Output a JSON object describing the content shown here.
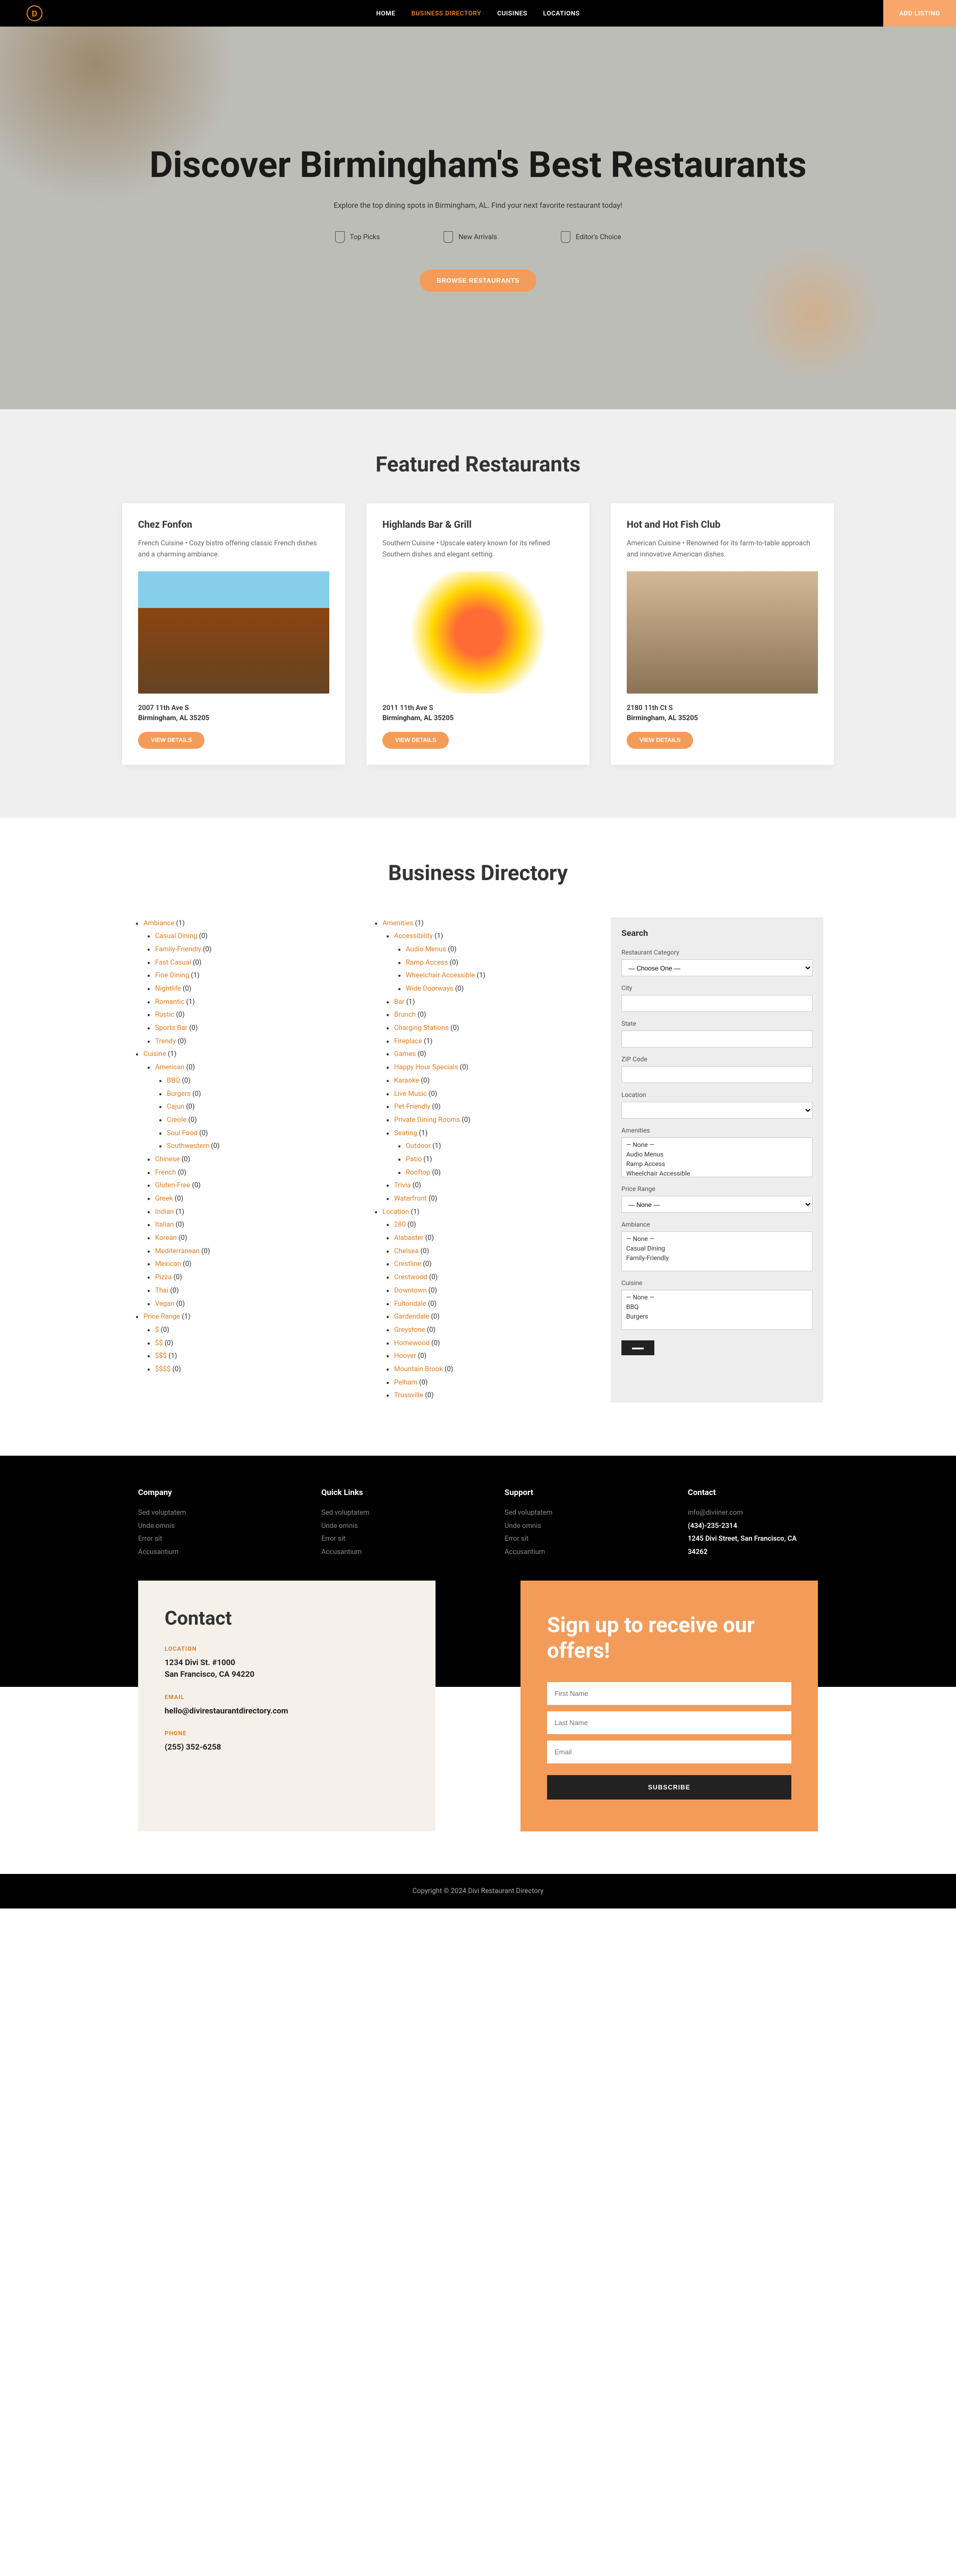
{
  "header": {
    "nav": [
      "HOME",
      "BUSINESS DIRECTORY",
      "CUISINES",
      "LOCATIONS"
    ],
    "cta": "ADD LISTING"
  },
  "hero": {
    "title": "Discover Birmingham's Best Restaurants",
    "subtitle": "Explore the top dining spots in Birmingham, AL. Find your next favorite restaurant today!",
    "badges": [
      "Top Picks",
      "New Arrivals",
      "Editor's Choice"
    ],
    "button": "BROWSE RESTAURANTS"
  },
  "featured": {
    "title": "Featured Restaurants",
    "cards": [
      {
        "name": "Chez Fonfon",
        "desc": "French Cuisine • Cozy bistro offering classic French dishes and a charming ambiance.",
        "addr": "2007 11th Ave S",
        "city": "Birmingham, AL 35205",
        "btn": "VIEW DETAILS"
      },
      {
        "name": "Highlands Bar & Grill",
        "desc": "Southern Cuisine • Upscale eatery known for its refined Southern dishes and elegant setting.",
        "addr": "2011 11th Ave S",
        "city": "Birmingham, AL 35205",
        "btn": "VIEW DETAILS"
      },
      {
        "name": "Hot and Hot Fish Club",
        "desc": "American Cuisine • Renowned for its farm-to-table approach and innovative American dishes.",
        "addr": "2180 11th Ct S",
        "city": "Birmingham, AL 35205",
        "btn": "VIEW DETAILS"
      }
    ]
  },
  "directory": {
    "title": "Business Directory",
    "col1": [
      {
        "label": "Ambiance",
        "count": "(1)",
        "children": [
          {
            "label": "Casual Dining",
            "count": "(0)"
          },
          {
            "label": "Family-Friendly",
            "count": "(0)"
          },
          {
            "label": "Fast Casual",
            "count": "(0)"
          },
          {
            "label": "Fine Dining",
            "count": "(1)"
          },
          {
            "label": "Nightlife",
            "count": "(0)"
          },
          {
            "label": "Romantic",
            "count": "(1)"
          },
          {
            "label": "Rustic",
            "count": "(0)"
          },
          {
            "label": "Sports Bar",
            "count": "(0)"
          },
          {
            "label": "Trendy",
            "count": "(0)"
          }
        ]
      },
      {
        "label": "Cuisine",
        "count": "(1)",
        "children": [
          {
            "label": "American",
            "count": "(0)",
            "children": [
              {
                "label": "BBQ",
                "count": "(0)"
              },
              {
                "label": "Burgers",
                "count": "(0)"
              },
              {
                "label": "Cajun",
                "count": "(0)"
              },
              {
                "label": "Creole",
                "count": "(0)"
              },
              {
                "label": "Soul Food",
                "count": "(0)"
              },
              {
                "label": "Southwestern",
                "count": "(0)"
              }
            ]
          },
          {
            "label": "Chinese",
            "count": "(0)"
          },
          {
            "label": "French",
            "count": "(0)"
          },
          {
            "label": "Gluten-Free",
            "count": "(0)"
          },
          {
            "label": "Greek",
            "count": "(0)"
          },
          {
            "label": "Indian",
            "count": "(1)"
          },
          {
            "label": "Italian",
            "count": "(0)"
          },
          {
            "label": "Korean",
            "count": "(0)"
          },
          {
            "label": "Mediterranean",
            "count": "(0)"
          },
          {
            "label": "Mexican",
            "count": "(0)"
          },
          {
            "label": "Pizza",
            "count": "(0)"
          },
          {
            "label": "Thai",
            "count": "(0)"
          },
          {
            "label": "Vegan",
            "count": "(0)"
          }
        ]
      },
      {
        "label": "Price Range",
        "count": "(1)",
        "children": [
          {
            "label": "$",
            "count": "(0)"
          },
          {
            "label": "$$",
            "count": "(0)"
          },
          {
            "label": "$$$",
            "count": "(1)"
          },
          {
            "label": "$$$$",
            "count": "(0)"
          }
        ]
      }
    ],
    "col2": [
      {
        "label": "Amenities",
        "count": "(1)",
        "children": [
          {
            "label": "Accessibility",
            "count": "(1)",
            "children": [
              {
                "label": "Audio Menus",
                "count": "(0)"
              },
              {
                "label": "Ramp Access",
                "count": "(0)"
              },
              {
                "label": "Wheelchair Accessible",
                "count": "(1)"
              },
              {
                "label": "Wide Doorways",
                "count": "(0)"
              }
            ]
          },
          {
            "label": "Bar",
            "count": "(1)"
          },
          {
            "label": "Brunch",
            "count": "(0)"
          },
          {
            "label": "Charging Stations",
            "count": "(0)"
          },
          {
            "label": "Fireplace",
            "count": "(1)"
          },
          {
            "label": "Games",
            "count": "(0)"
          },
          {
            "label": "Happy Hour Specials",
            "count": "(0)"
          },
          {
            "label": "Karaoke",
            "count": "(0)"
          },
          {
            "label": "Live Music",
            "count": "(0)"
          },
          {
            "label": "Pet-Friendly",
            "count": "(0)"
          },
          {
            "label": "Private Dining Rooms",
            "count": "(0)"
          },
          {
            "label": "Seating",
            "count": "(1)",
            "children": [
              {
                "label": "Outdoor",
                "count": "(1)"
              },
              {
                "label": "Patio",
                "count": "(1)"
              },
              {
                "label": "Rooftop",
                "count": "(0)"
              }
            ]
          },
          {
            "label": "Trivia",
            "count": "(0)"
          },
          {
            "label": "Waterfront",
            "count": "(0)"
          }
        ]
      },
      {
        "label": "Location",
        "count": "(1)",
        "children": [
          {
            "label": "280",
            "count": "(0)"
          },
          {
            "label": "Alabaster",
            "count": "(0)"
          },
          {
            "label": "Chelsea",
            "count": "(0)"
          },
          {
            "label": "Crestline",
            "count": "(0)"
          },
          {
            "label": "Crestwood",
            "count": "(0)"
          },
          {
            "label": "Downtown",
            "count": "(0)"
          },
          {
            "label": "Fultondale",
            "count": "(0)"
          },
          {
            "label": "Gardendale",
            "count": "(0)"
          },
          {
            "label": "Greystone",
            "count": "(0)"
          },
          {
            "label": "Homewood",
            "count": "(0)"
          },
          {
            "label": "Hoover",
            "count": "(0)"
          },
          {
            "label": "Mountain Brook",
            "count": "(0)"
          },
          {
            "label": "Pelham",
            "count": "(0)"
          },
          {
            "label": "Trussville",
            "count": "(0)"
          }
        ]
      }
    ],
    "search": {
      "title": "Search",
      "labels": {
        "cat": "Restaurant Category",
        "city": "City",
        "state": "State",
        "zip": "ZIP Code",
        "loc": "Location",
        "amen": "Amenities",
        "price": "Price Range",
        "amb": "Ambiance",
        "cui": "Cuisine"
      },
      "catDefault": "— Choose One —",
      "priceDefault": "— None —",
      "amenOpts": [
        "— None —",
        "Audio Menus",
        "Ramp Access",
        "Wheelchair Accessible"
      ],
      "ambOpts": [
        "— None —",
        "Casual Dining",
        "Family-Friendly"
      ],
      "cuiOpts": [
        "— None —",
        "BBQ",
        "Burgers"
      ]
    }
  },
  "footer": {
    "cols": [
      {
        "title": "Company",
        "links": [
          "Sed voluptatem",
          "Unde omnis",
          "Error sit",
          "Accusantium"
        ]
      },
      {
        "title": "Quick Links",
        "links": [
          "Sed voluptatem",
          "Unde omnis",
          "Error sit",
          "Accusantium"
        ]
      },
      {
        "title": "Support",
        "links": [
          "Sed voluptatem",
          "Unde omnis",
          "Error sit",
          "Accusantium"
        ]
      },
      {
        "title": "Contact",
        "links": [
          "info@diviiner.com"
        ],
        "white": [
          "(434)-235-2314",
          "1245 Divi Street, San Francisco, CA 34262"
        ]
      }
    ]
  },
  "contact": {
    "title": "Contact",
    "sections": [
      {
        "label": "LOCATION",
        "val": "1234 Divi St. #1000\nSan Francisco, CA 94220"
      },
      {
        "label": "EMAIL",
        "val": "hello@divirestaurantdirectory.com"
      },
      {
        "label": "PHONE",
        "val": "(255) 352-6258"
      }
    ]
  },
  "signup": {
    "title": "Sign up to receive our offers!",
    "placeholders": [
      "First Name",
      "Last Name",
      "Email"
    ],
    "button": "SUBSCRIBE"
  },
  "copyright": "Copyright © 2024 Divi Restaurant Directory"
}
